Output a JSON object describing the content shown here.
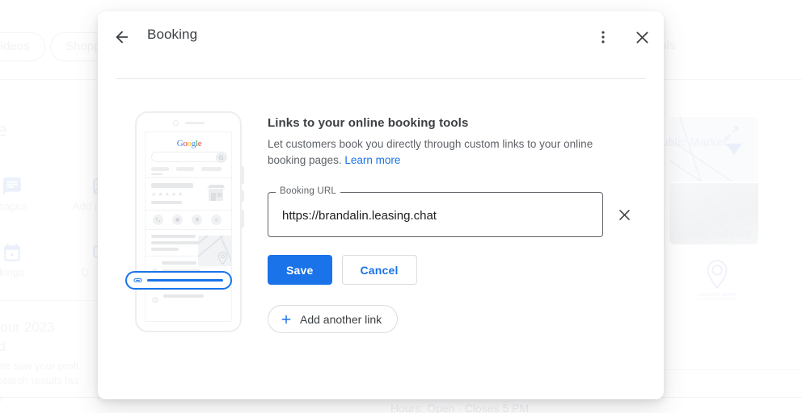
{
  "background": {
    "chips": [
      {
        "label": "Videos"
      },
      {
        "label": "Shopping"
      },
      {
        "label": "ools"
      }
    ],
    "profile_word": "le",
    "actions": [
      {
        "icon": "message-icon",
        "label": "ssages"
      },
      {
        "icon": "photo-icon",
        "label": "Add p"
      },
      {
        "icon": "calendar-icon",
        "label": "okings"
      },
      {
        "icon": "ask-icon",
        "label": "Q"
      }
    ],
    "performance_lines": [
      "your 2023",
      "rd",
      "ople saw your profi",
      "r search results las",
      "n"
    ],
    "map_label": "ublic Market",
    "see_outside": "See outside",
    "pin_brand": "LEASING CHAT",
    "pin_sub": "SACRAMENTO MARKET",
    "hours": "Hours: Open · Closes 5 PM"
  },
  "modal": {
    "title": "Booking",
    "back_icon": "back-arrow-icon",
    "menu_icon": "more-vert-icon",
    "close_icon": "close-icon",
    "section": {
      "heading": "Links to your online booking tools",
      "description_before": "Let customers book you directly through custom links to your online booking pages. ",
      "learn_more": "Learn more"
    },
    "field": {
      "label": "Booking URL",
      "value": "https://brandalin.leasing.chat",
      "placeholder": "",
      "clear_icon": "close-icon"
    },
    "buttons": {
      "save": "Save",
      "cancel": "Cancel",
      "add_another": "Add another link",
      "add_icon": "plus-icon"
    }
  },
  "phone_mockup": {
    "google_logo": [
      "G",
      "o",
      "o",
      "g",
      "l",
      "e"
    ],
    "search_icon": "search-icon",
    "store_icon": "storefront-icon",
    "action_icons": [
      "call-icon",
      "directions-icon",
      "save-icon",
      "share-icon"
    ],
    "chevron_icon": "chevron-right-icon",
    "place_icon": "place-pin-icon",
    "hours_icon": "clock-icon",
    "link_icon": "link-icon",
    "web_icon": "globe-icon"
  },
  "colors": {
    "accent_blue": "#1a73e8",
    "text_primary": "#3c4043",
    "text_secondary": "#5f6368",
    "border": "#dadce0",
    "divider": "#e8eaed"
  }
}
